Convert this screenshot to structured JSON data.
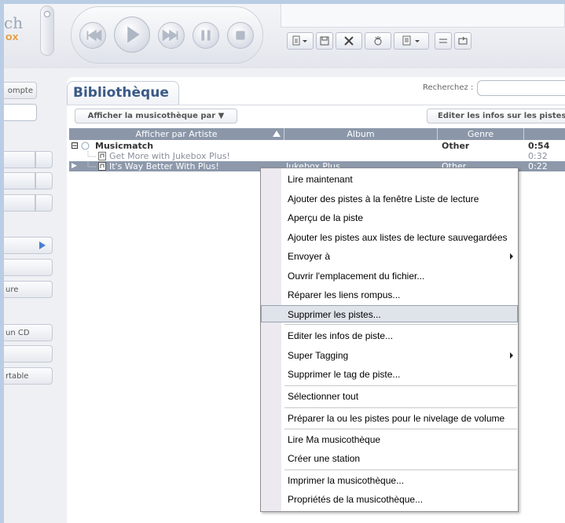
{
  "brand": {
    "line1": "ch",
    "line2": "OX"
  },
  "sidebar": {
    "account_label": "ompte",
    "folder_label": "ure",
    "cd_label": "un CD",
    "portable_label": "rtable"
  },
  "library": {
    "title": "Bibliothèque",
    "search_label": "Recherchez :",
    "search_value": "",
    "view_by_label": "Afficher la musicothèque par ▼",
    "edit_info_label": "Editer les infos sur les pistes"
  },
  "grid": {
    "columns": [
      "Afficher par Artiste",
      "Album",
      "Genre",
      ""
    ],
    "rows": [
      {
        "expander": "⊟",
        "title": "Musicmatch",
        "album": "",
        "genre": "Other",
        "time": "0:54",
        "kind": "group"
      },
      {
        "expander": "",
        "title": "Get More with Jukebox Plus!",
        "album": "",
        "genre": "",
        "time": "0:32",
        "kind": "track"
      },
      {
        "expander": "▶",
        "title": "It's Way Better With Plus!",
        "album": "Jukebox Plus",
        "genre": "Other",
        "time": "0:22",
        "kind": "selected"
      }
    ]
  },
  "context_menu": {
    "items": [
      {
        "label": "Lire maintenant"
      },
      {
        "label": "Ajouter des pistes à la fenêtre Liste de lecture"
      },
      {
        "label": "Aperçu de la piste"
      },
      {
        "label": "Ajouter les pistes aux listes de lecture sauvegardées"
      },
      {
        "label": "Envoyer à",
        "submenu": true
      },
      {
        "label": "Ouvrir l'emplacement du fichier..."
      },
      {
        "label": "Réparer les liens rompus..."
      },
      {
        "label": "Supprimer les pistes...",
        "highlighted": true
      },
      {
        "label": "Editer les infos de piste..."
      },
      {
        "label": "Super Tagging",
        "submenu": true
      },
      {
        "label": "Supprimer le tag de piste..."
      },
      {
        "label": "Sélectionner tout"
      },
      {
        "label": "Préparer la ou les pistes pour le nivelage de volume"
      },
      {
        "label": "Lire Ma musicothèque"
      },
      {
        "label": "Créer une station"
      },
      {
        "label": "Imprimer la musicothèque..."
      },
      {
        "label": "Propriétés de la musicothèque..."
      }
    ]
  },
  "colors": {
    "frame": "#b9cde5",
    "header": "#8b97a9",
    "title": "#3a5a86",
    "accent": "#4a7fd0"
  }
}
